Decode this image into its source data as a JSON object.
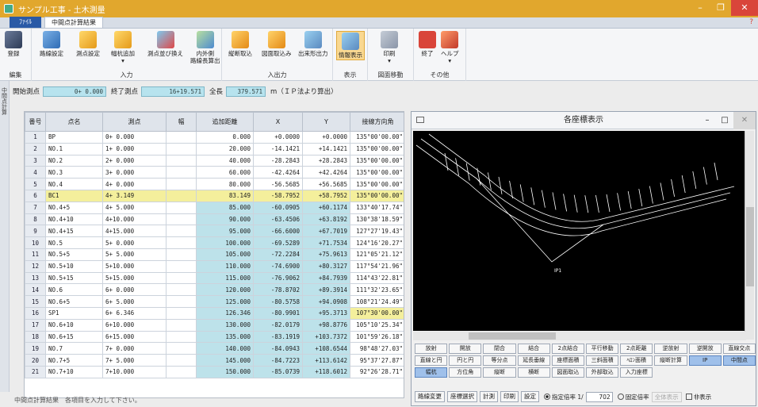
{
  "window": {
    "title": "サンプル工事 - 土木測量"
  },
  "tabs": {
    "file": "ﾌｧｲﾙ",
    "active": "中間点計算結果"
  },
  "ribbon": {
    "groups": [
      {
        "label": "編集",
        "buttons": [
          "登録"
        ]
      },
      {
        "label": "入力",
        "buttons": [
          "路線設定",
          "測点設定",
          "幅杭追加",
          "測点並び換え",
          "内外側\n路線長算出"
        ]
      },
      {
        "label": "入出力",
        "buttons": [
          "縦断取込",
          "図面取込み",
          "出来形出力"
        ]
      },
      {
        "label": "表示",
        "buttons": [
          "情報表示"
        ]
      },
      {
        "label": "図面移動",
        "buttons": [
          "印刷"
        ]
      },
      {
        "label": "その他",
        "buttons": [
          "終了",
          "ヘルプ"
        ]
      }
    ]
  },
  "sidebar": {
    "label": "中間点計算"
  },
  "range": {
    "start_label": "開始測点",
    "start_value": "0+ 0.000",
    "end_label": "終了測点",
    "end_value": "16+19.571",
    "total_label": "全長",
    "total_value": "379.571",
    "unit_note": "m（ＩＰ法より算出）"
  },
  "table": {
    "headers": [
      "番号",
      "点名",
      "測点",
      "幅",
      "追加距離",
      "X",
      "Y",
      "接線方向角"
    ],
    "rows": [
      [
        "1",
        "BP",
        "0+ 0.000",
        "",
        "0.000",
        "+0.0000",
        "+0.0000",
        "135°00'00.00\""
      ],
      [
        "2",
        "NO.1",
        "1+ 0.000",
        "",
        "20.000",
        "-14.1421",
        "+14.1421",
        "135°00'00.00\""
      ],
      [
        "3",
        "NO.2",
        "2+ 0.000",
        "",
        "40.000",
        "-28.2843",
        "+28.2843",
        "135°00'00.00\""
      ],
      [
        "4",
        "NO.3",
        "3+ 0.000",
        "",
        "60.000",
        "-42.4264",
        "+42.4264",
        "135°00'00.00\""
      ],
      [
        "5",
        "NO.4",
        "4+ 0.000",
        "",
        "80.000",
        "-56.5685",
        "+56.5685",
        "135°00'00.00\""
      ],
      [
        "6",
        "BC1",
        "4+ 3.149",
        "",
        "83.149",
        "-58.7952",
        "+58.7952",
        "135°00'00.00\""
      ],
      [
        "7",
        "NO.4+5",
        "4+ 5.000",
        "",
        "85.000",
        "-60.0905",
        "+60.1174",
        "133°40'17.74\""
      ],
      [
        "8",
        "NO.4+10",
        "4+10.000",
        "",
        "90.000",
        "-63.4506",
        "+63.8192",
        "130°38'18.59\""
      ],
      [
        "9",
        "NO.4+15",
        "4+15.000",
        "",
        "95.000",
        "-66.6000",
        "+67.7019",
        "127°27'19.43\""
      ],
      [
        "10",
        "NO.5",
        "5+ 0.000",
        "",
        "100.000",
        "-69.5289",
        "+71.7534",
        "124°16'20.27\""
      ],
      [
        "11",
        "NO.5+5",
        "5+ 5.000",
        "",
        "105.000",
        "-72.2284",
        "+75.9613",
        "121°05'21.12\""
      ],
      [
        "12",
        "NO.5+10",
        "5+10.000",
        "",
        "110.000",
        "-74.6900",
        "+80.3127",
        "117°54'21.96\""
      ],
      [
        "13",
        "NO.5+15",
        "5+15.000",
        "",
        "115.000",
        "-76.9062",
        "+84.7939",
        "114°43'22.81\""
      ],
      [
        "14",
        "NO.6",
        "6+ 0.000",
        "",
        "120.000",
        "-78.8702",
        "+89.3914",
        "111°32'23.65\""
      ],
      [
        "15",
        "NO.6+5",
        "6+ 5.000",
        "",
        "125.000",
        "-80.5758",
        "+94.0908",
        "108°21'24.49\""
      ],
      [
        "16",
        "SP1",
        "6+ 6.346",
        "",
        "126.346",
        "-80.9901",
        "+95.3713",
        "107°30'00.00\""
      ],
      [
        "17",
        "NO.6+10",
        "6+10.000",
        "",
        "130.000",
        "-82.0179",
        "+98.8776",
        "105°10'25.34\""
      ],
      [
        "18",
        "NO.6+15",
        "6+15.000",
        "",
        "135.000",
        "-83.1919",
        "+103.7372",
        "101°59'26.18\""
      ],
      [
        "19",
        "NO.7",
        "7+ 0.000",
        "",
        "140.000",
        "-84.0943",
        "+108.6544",
        "98°48'27.03\""
      ],
      [
        "20",
        "NO.7+5",
        "7+ 5.000",
        "",
        "145.000",
        "-84.7223",
        "+113.6142",
        "95°37'27.87\""
      ],
      [
        "21",
        "NO.7+10",
        "7+10.000",
        "",
        "150.000",
        "-85.0739",
        "+118.6012",
        "92°26'28.71\""
      ]
    ]
  },
  "coord_window": {
    "title": "各座標表示",
    "plot_label": "IP1",
    "buttons": [
      "放射",
      "開放",
      "閉合",
      "結合",
      "2点結合",
      "平行移動",
      "2点距離",
      "逆放射",
      "逆開放",
      "直線交点",
      "直線と円",
      "円と円",
      "等分点",
      "延長垂線",
      "座標面積",
      "三斜面積",
      "ﾍﾛﾝ面積",
      "縦断計算",
      "IP",
      "中間点",
      "幅杭",
      "方位角",
      "縦断",
      "横断",
      "図面取込",
      "外部取込",
      "入力座標"
    ],
    "footer": {
      "btn1": "路線変更",
      "btn2": "座標選択",
      "btn3": "計測",
      "btn4": "印刷",
      "btn5": "設定",
      "scale_label": "指定倍率 1/",
      "scale_value": "702",
      "fixed_label": "固定倍率",
      "select_value": "全体表示",
      "hide_label": "非表示"
    }
  },
  "status": {
    "text": "中間点計算結果　各項目を入力して下さい。"
  }
}
